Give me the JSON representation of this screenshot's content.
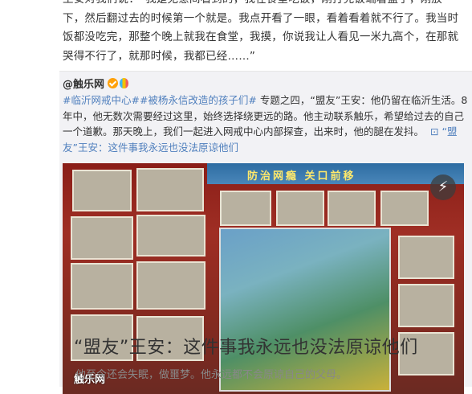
{
  "post": {
    "paragraph": "王安对我们说：“我是无意间看到的，我在食堂吃饭，刚打完饭端着盘子，刚放下，然后翻过去的时候第一个就是。我点开看了一眼，看着看着就不行了。我当时饭都没吃完，那整个晚上就我在食堂，我摸，你说我让人看见一米九高个，在那就哭得不行了，就那时候，我都已经……”"
  },
  "repost": {
    "author": "@触乐网",
    "tags": [
      "#临沂网戒中心#",
      "#被杨永信改造的孩子们#"
    ],
    "text": "专题之四，“盟友”王安：他仍留在临沂生活。8年中，他无数次需要经过这里，始终选择绕更远的路。他主动联系触乐，希望给过去的自己一个道歉。那天晚上，我们一起进入网戒中心内部探查，出来时，他的腿在发抖。",
    "link_text": "“盟友”王安：这件事我永远也没法原谅他们",
    "image": {
      "board_title": "防治网瘾 关口前移",
      "watermark": "触乐网"
    },
    "card": {
      "title": "“盟友”王安：这件事我永远也没法原谅他们",
      "subtitle": "他至今还会失眠，做噩梦。他永远都不会原谅自己的父母。"
    }
  },
  "icons": {
    "verified": "verified-badge-icon",
    "balloon": "colored-balloon-icon",
    "gif": "gif-play-icon",
    "link": "link-icon"
  },
  "colors": {
    "link": "#4f7fbd",
    "card_background": "#f2f2f5"
  }
}
